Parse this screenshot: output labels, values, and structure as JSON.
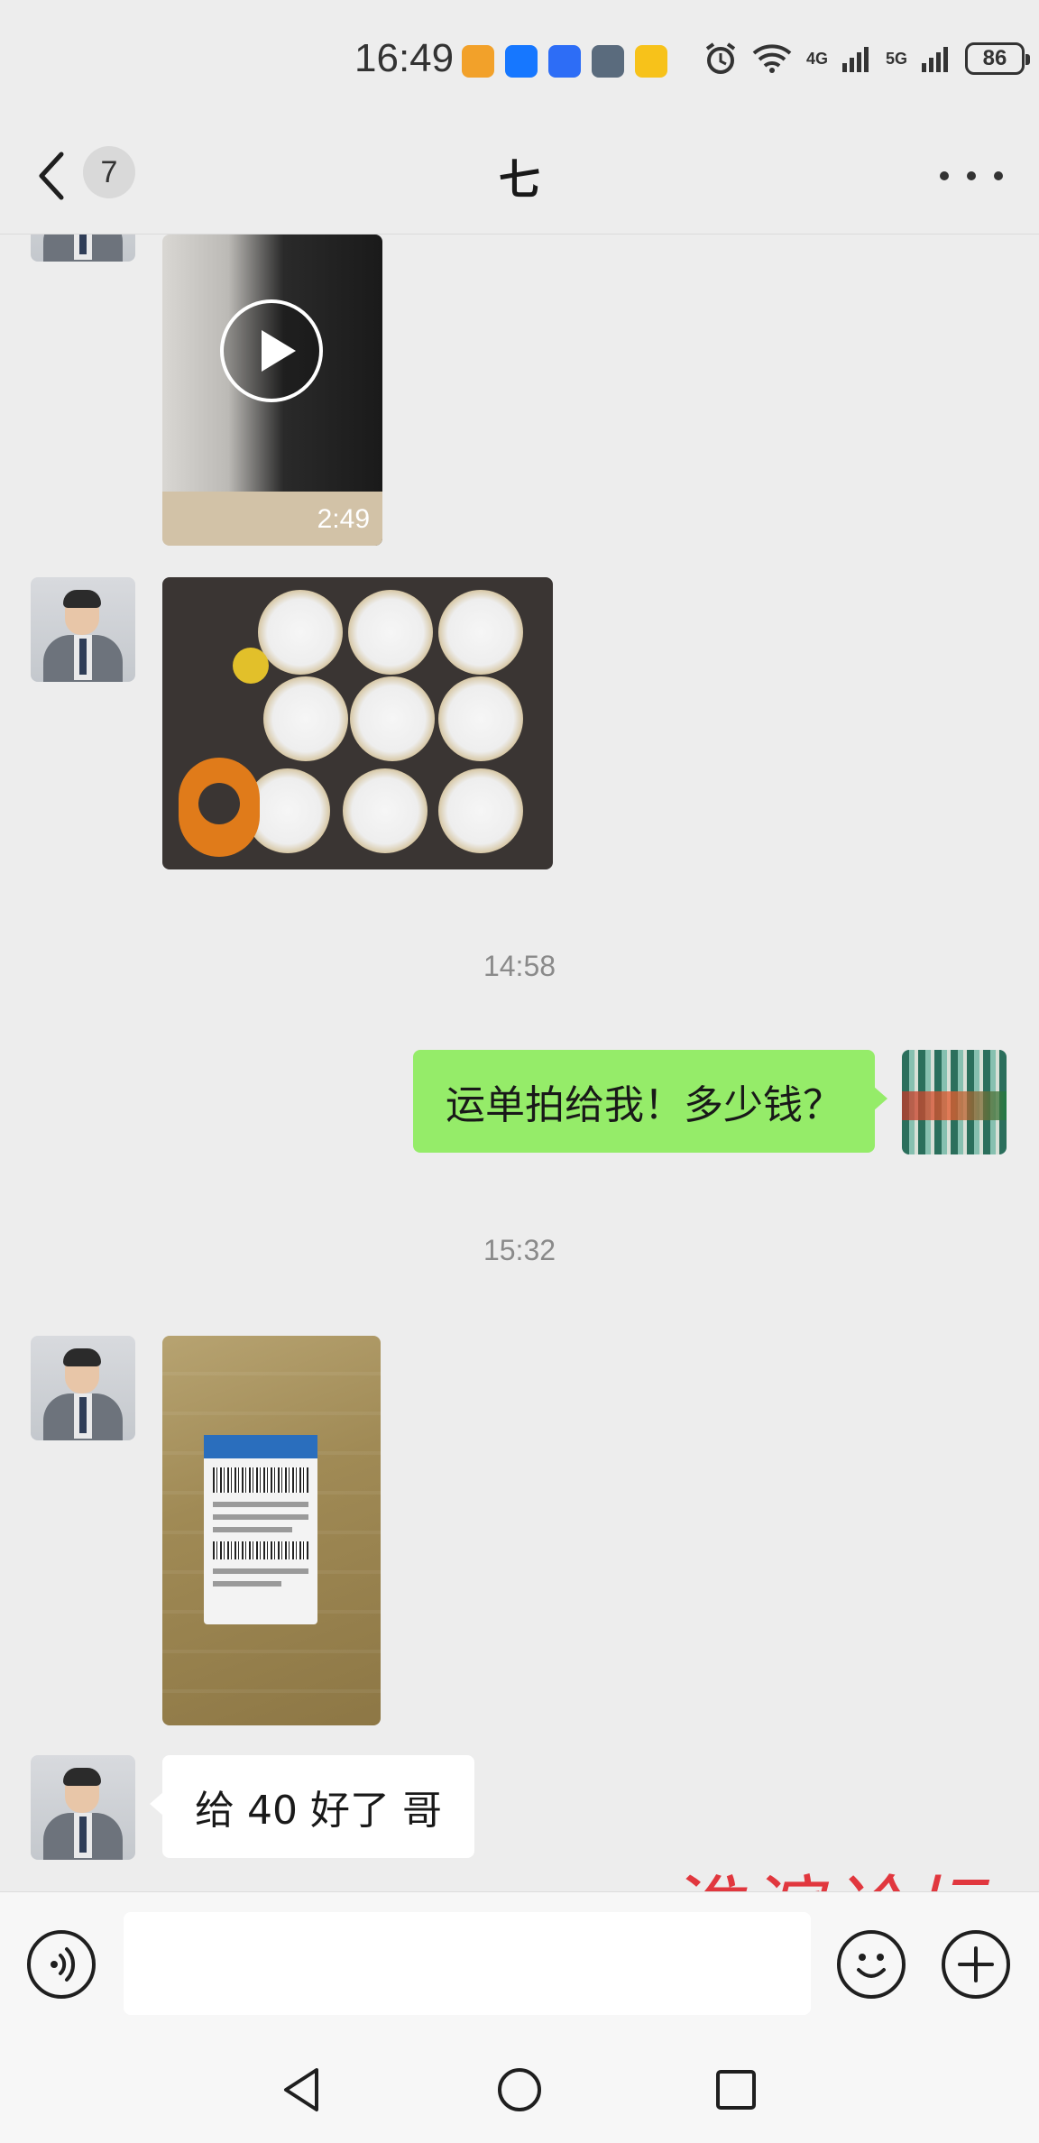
{
  "status_bar": {
    "time": "16:49",
    "network_1": "4G",
    "network_2": "5G",
    "battery": "86",
    "app_icons": [
      "notification-app-icon",
      "alipay-icon",
      "voice-app-icon",
      "game-app-icon",
      "taxi-app-icon"
    ]
  },
  "header": {
    "unread_count": "7",
    "title": "七"
  },
  "messages": {
    "video_duration": "2:49",
    "time_1": "14:58",
    "sent_text": "运单拍给我！多少钱？",
    "time_2": "15:32",
    "received_text": "给 40 好了 哥"
  },
  "watermark": "淮滨论坛",
  "colors": {
    "background": "#ededed",
    "sent_bubble": "#95ec69",
    "received_bubble": "#ffffff",
    "watermark": "#e0242c"
  }
}
